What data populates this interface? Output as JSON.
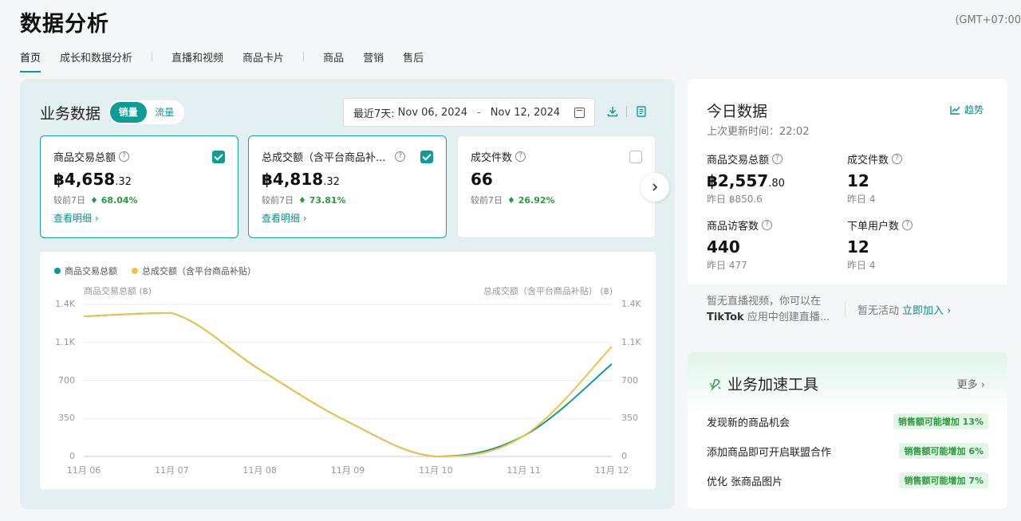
{
  "header": {
    "title": "数据分析",
    "timezone": "(GMT+07:00"
  },
  "nav": {
    "items": [
      "首页",
      "成长和数据分析",
      "直播和视频",
      "商品卡片",
      "商品",
      "营销",
      "售后"
    ]
  },
  "business": {
    "title": "业务数据",
    "toggle": [
      "销量",
      "流量"
    ],
    "date": {
      "label": "最近7天:",
      "start": "Nov 06, 2024",
      "sep": "-",
      "end": "Nov 12, 2024"
    },
    "kpis": [
      {
        "label": "商品交易总额",
        "currency": "฿",
        "value_int": "4,658",
        "value_dec": ".32",
        "compare_label": "较前7日",
        "change": "68.04%",
        "link": "查看明细 ›",
        "checked": true
      },
      {
        "label": "总成交额（含平台商品补...",
        "currency": "฿",
        "value_int": "4,818",
        "value_dec": ".32",
        "compare_label": "较前7日",
        "change": "73.81%",
        "link": "查看明细 ›",
        "checked": true
      },
      {
        "label": "成交件数",
        "currency": "",
        "value_int": "66",
        "value_dec": "",
        "compare_label": "较前7日",
        "change": "26.92%",
        "link": "",
        "checked": false
      }
    ]
  },
  "chart_data": {
    "type": "line",
    "legend": [
      "商品交易总额",
      "总成交额（含平台商品补贴）"
    ],
    "y_left_title": "商品交易总额 (฿)",
    "y_right_title": "总成交额（含平台商品补贴） (฿)",
    "y_ticks": [
      "0",
      "350",
      "700",
      "1.1K",
      "1.4K"
    ],
    "ylim": [
      0,
      1400
    ],
    "x": [
      "11月 06",
      "11月 07",
      "11月 08",
      "11月 09",
      "11月 10",
      "11月 11",
      "11月 12"
    ],
    "series": [
      {
        "name": "商品交易总额",
        "color": "#0f9a93",
        "values": [
          1290,
          1320,
          800,
          320,
          0,
          190,
          850
        ]
      },
      {
        "name": "总成交额（含平台商品补贴）",
        "color": "#f0c24b",
        "values": [
          1290,
          1320,
          800,
          320,
          0,
          190,
          1010
        ]
      }
    ],
    "legend_position": "top-left",
    "grid": true
  },
  "today": {
    "title": "今日数据",
    "trend": "趋势",
    "updated": "上次更新时间：22:02",
    "metrics": [
      {
        "label": "商品交易总额",
        "currency": "฿",
        "value_int": "2,557",
        "value_dec": ".80",
        "prev": "昨日 ฿850.6"
      },
      {
        "label": "成交件数",
        "currency": "",
        "value_int": "12",
        "value_dec": "",
        "prev": "昨日 4"
      },
      {
        "label": "商品访客数",
        "currency": "",
        "value_int": "440",
        "value_dec": "",
        "prev": "昨日 477"
      },
      {
        "label": "下单用户数",
        "currency": "",
        "value_int": "12",
        "value_dec": "",
        "prev": "昨日 4"
      }
    ],
    "footer": {
      "live_line1": "暂无直播视频，你可以在",
      "live_bold": "TikTok",
      "live_line2": " 应用中创建直播...",
      "activity": "暂无活动",
      "join": "立即加入 ›"
    }
  },
  "accelerator": {
    "title": "业务加速工具",
    "more": "更多 ›",
    "items": [
      {
        "text": "发现新的商品机会",
        "badge": "销售额可能增加 13%"
      },
      {
        "text": "添加商品即可开启联盟合作",
        "badge": "销售额可能增加 6%"
      },
      {
        "text": "优化 张商品图片",
        "badge": "销售额可能增加 7%"
      }
    ]
  },
  "colors": {
    "accent": "#0d9d94",
    "positive": "#2a9a3a",
    "panel_bg": "#e3eff0"
  }
}
